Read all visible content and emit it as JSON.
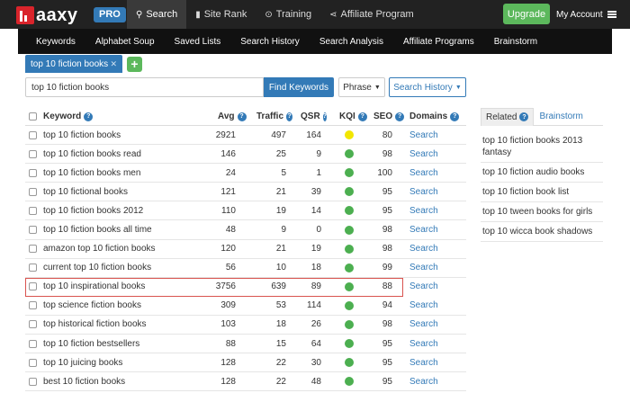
{
  "header": {
    "logo_text": "aaxy",
    "pro_label": "PRO",
    "nav": [
      {
        "label": "Search",
        "icon": "search-icon",
        "glyph": "⚲"
      },
      {
        "label": "Site Rank",
        "icon": "bar-chart-icon",
        "glyph": "▮"
      },
      {
        "label": "Training",
        "icon": "play-circle-icon",
        "glyph": "⊙"
      },
      {
        "label": "Affiliate Program",
        "icon": "share-icon",
        "glyph": "⋖"
      }
    ],
    "upgrade_label": "Upgrade",
    "account_label": "My Account"
  },
  "subnav": [
    "Keywords",
    "Alphabet Soup",
    "Saved Lists",
    "Search History",
    "Search Analysis",
    "Affiliate Programs",
    "Brainstorm"
  ],
  "keyword_tab": {
    "label": "top 10 fiction books",
    "close": "✕"
  },
  "add_label": "+",
  "search": {
    "value": "top 10 fiction books",
    "find_label": "Find Keywords",
    "phrase_label": "Phrase",
    "history_label": "Search History"
  },
  "colors": {
    "kqi_yellow": "#f2e600",
    "kqi_green": "#4caf50",
    "accent": "#337ab7",
    "highlight": "#d9534f"
  },
  "table": {
    "columns": [
      "Keyword",
      "Avg",
      "Traffic",
      "QSR",
      "KQI",
      "SEO",
      "Domains"
    ],
    "help_glyph": "?",
    "rows": [
      {
        "keyword": "top 10 fiction books",
        "avg": "2921",
        "traffic": "497",
        "qsr": "164",
        "kqi": "yellow",
        "seo": "80",
        "domains": "Search"
      },
      {
        "keyword": "top 10 fiction books read",
        "avg": "146",
        "traffic": "25",
        "qsr": "9",
        "kqi": "green",
        "seo": "98",
        "domains": "Search"
      },
      {
        "keyword": "top 10 fiction books men",
        "avg": "24",
        "traffic": "5",
        "qsr": "1",
        "kqi": "green",
        "seo": "100",
        "domains": "Search"
      },
      {
        "keyword": "top 10 fictional books",
        "avg": "121",
        "traffic": "21",
        "qsr": "39",
        "kqi": "green",
        "seo": "95",
        "domains": "Search"
      },
      {
        "keyword": "top 10 fiction books 2012",
        "avg": "110",
        "traffic": "19",
        "qsr": "14",
        "kqi": "green",
        "seo": "95",
        "domains": "Search"
      },
      {
        "keyword": "top 10 fiction books all time",
        "avg": "48",
        "traffic": "9",
        "qsr": "0",
        "kqi": "green",
        "seo": "98",
        "domains": "Search"
      },
      {
        "keyword": "amazon top 10 fiction books",
        "avg": "120",
        "traffic": "21",
        "qsr": "19",
        "kqi": "green",
        "seo": "98",
        "domains": "Search"
      },
      {
        "keyword": "current top 10 fiction books",
        "avg": "56",
        "traffic": "10",
        "qsr": "18",
        "kqi": "green",
        "seo": "99",
        "domains": "Search"
      },
      {
        "keyword": "top 10 inspirational books",
        "avg": "3756",
        "traffic": "639",
        "qsr": "89",
        "kqi": "green",
        "seo": "88",
        "domains": "Search",
        "highlight": true
      },
      {
        "keyword": "top science fiction books",
        "avg": "309",
        "traffic": "53",
        "qsr": "114",
        "kqi": "green",
        "seo": "94",
        "domains": "Search"
      },
      {
        "keyword": "top historical fiction books",
        "avg": "103",
        "traffic": "18",
        "qsr": "26",
        "kqi": "green",
        "seo": "98",
        "domains": "Search"
      },
      {
        "keyword": "top 10 fiction bestsellers",
        "avg": "88",
        "traffic": "15",
        "qsr": "64",
        "kqi": "green",
        "seo": "95",
        "domains": "Search"
      },
      {
        "keyword": "top 10 juicing books",
        "avg": "128",
        "traffic": "22",
        "qsr": "30",
        "kqi": "green",
        "seo": "95",
        "domains": "Search"
      },
      {
        "keyword": "best 10 fiction books",
        "avg": "128",
        "traffic": "22",
        "qsr": "48",
        "kqi": "green",
        "seo": "95",
        "domains": "Search"
      }
    ]
  },
  "side": {
    "related_label": "Related",
    "brainstorm_label": "Brainstorm",
    "items": [
      "top 10 fiction books 2013 fantasy",
      "top 10 fiction audio books",
      "top 10 fiction book list",
      "top 10 tween books for girls",
      "top 10 wicca book shadows"
    ]
  }
}
